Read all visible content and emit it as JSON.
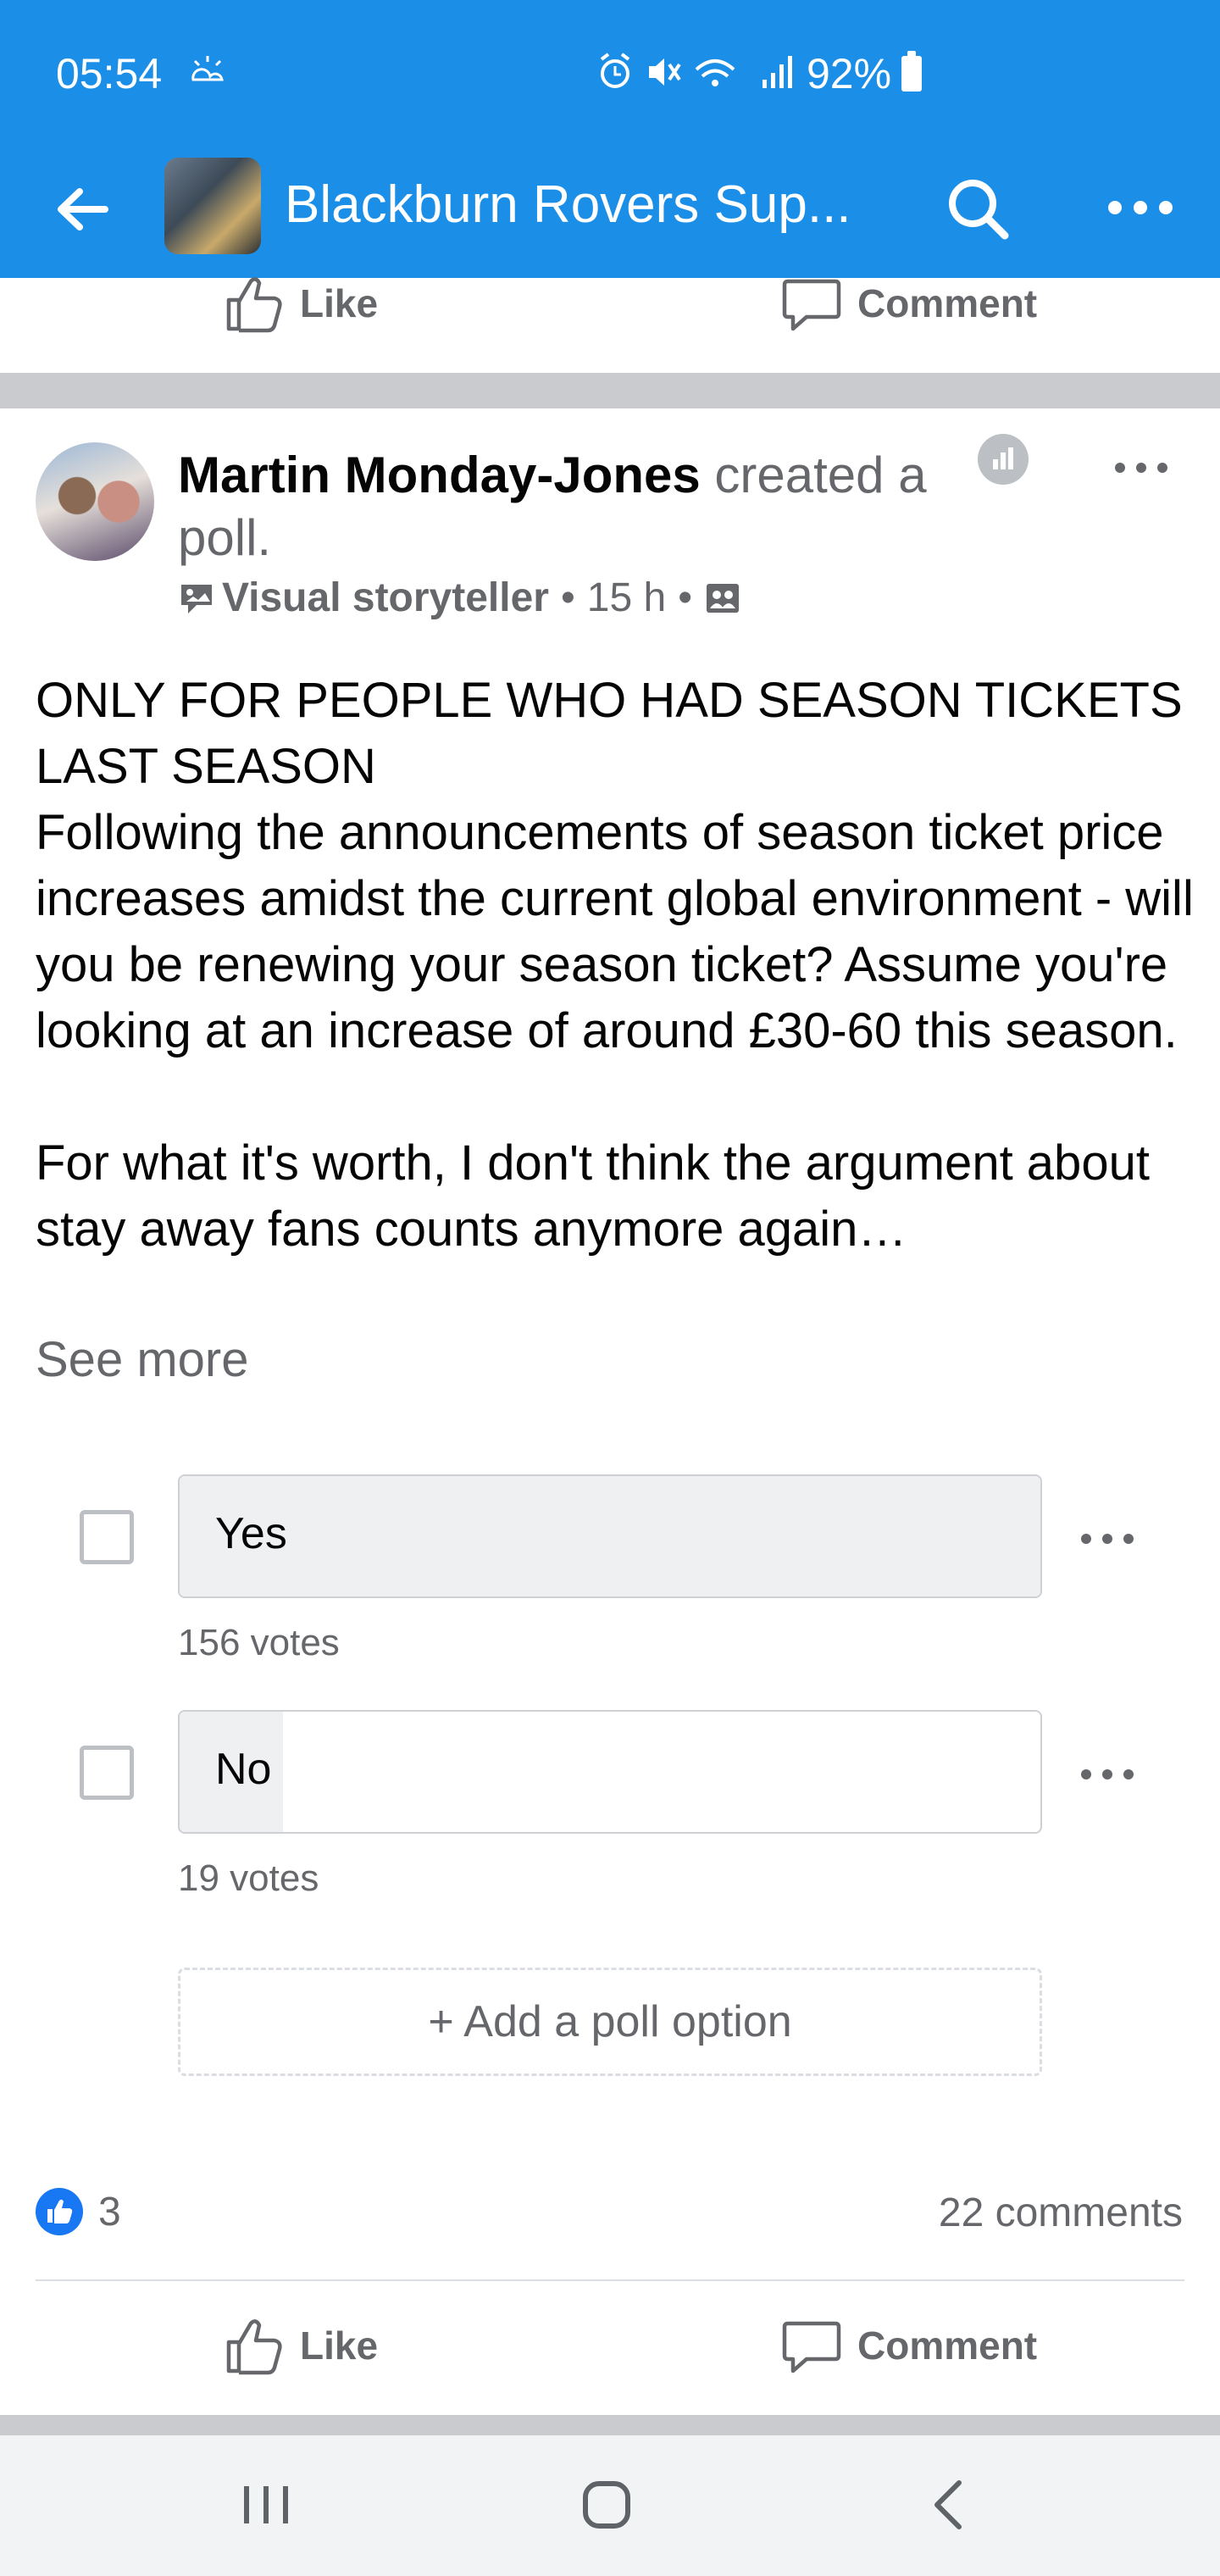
{
  "status_bar": {
    "time": "05:54",
    "battery": "92%"
  },
  "app_bar": {
    "title": "Blackburn Rovers Sup..."
  },
  "previous_post_actions": {
    "like_label": "Like",
    "comment_label": "Comment"
  },
  "post": {
    "author": "Martin Monday-Jones",
    "action_text": " created a poll.",
    "badge": "Visual storyteller",
    "time": "15 h",
    "body": "ONLY FOR PEOPLE WHO HAD SEASON TICKETS LAST SEASON\nFollowing the announcements of season ticket price increases amidst the current global environment - will you be renewing your season ticket? Assume you're looking at an increase of around £30-60 this season.\n\nFor what it's worth, I don't think the argument about stay away fans counts anymore again…",
    "see_more": "See more",
    "poll": {
      "options": [
        {
          "label": "Yes",
          "votes": "156 votes",
          "fill_fraction": 1.0
        },
        {
          "label": "No",
          "votes": "19 votes",
          "fill_fraction": 0.12
        }
      ],
      "add_option_label": "+ Add a poll option"
    },
    "reaction_count": "3",
    "comments_count": "22 comments",
    "like_label": "Like",
    "comment_label": "Comment"
  },
  "colors": {
    "brand_blue": "#1b8ee8",
    "like_blue": "#1877f2",
    "secondary_text": "#65676b"
  },
  "icons": {
    "back": "arrow-left-icon",
    "search": "search-icon",
    "more": "more-horizontal-icon",
    "like": "thumbs-up-icon",
    "comment": "speech-bubble-icon",
    "poll": "poll-icon",
    "audience": "group-audience-icon",
    "visual_storyteller": "storyteller-badge-icon"
  }
}
